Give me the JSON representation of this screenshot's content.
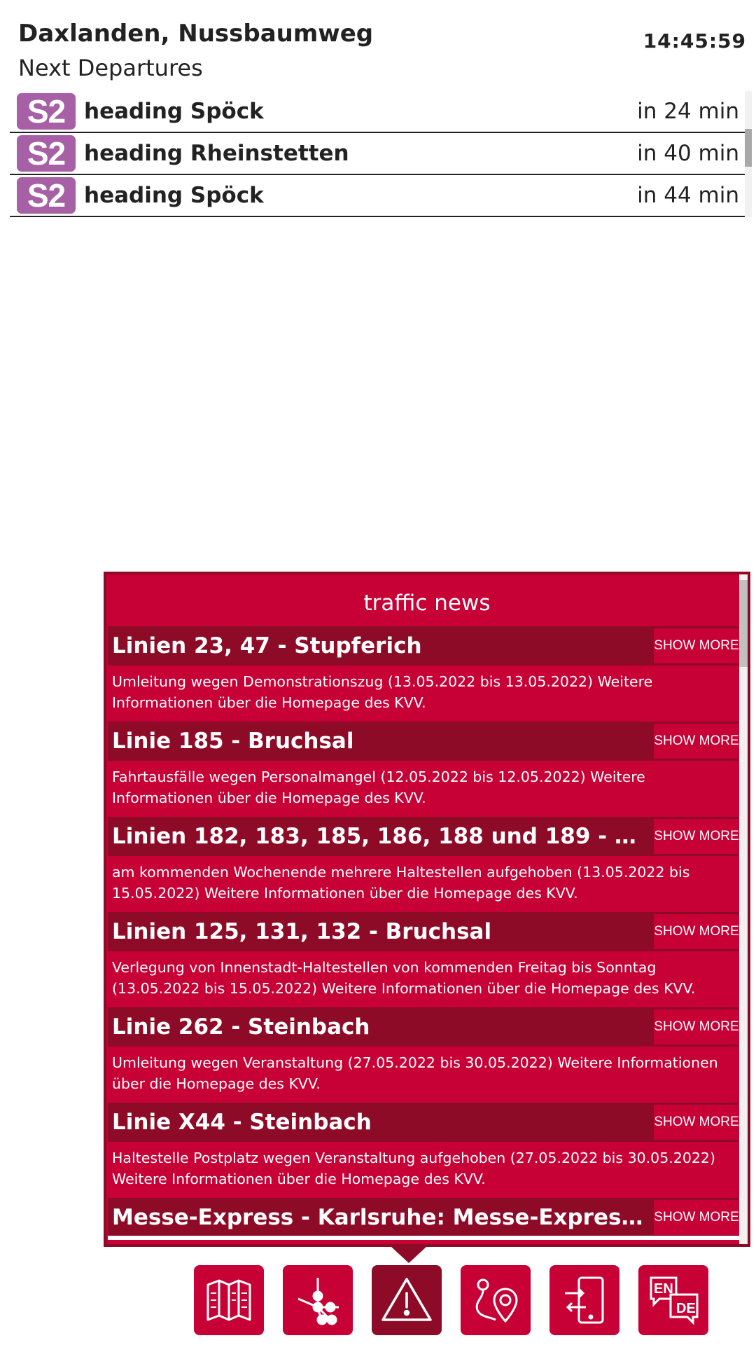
{
  "stop": {
    "name": "Daxlanden, Nussbaumweg",
    "subtitle": "Next Departures",
    "clock": "14:45:59"
  },
  "departures": [
    {
      "line": "S2",
      "destination": "heading Spöck",
      "time": "in 24 min"
    },
    {
      "line": "S2",
      "destination": "heading Rheinstetten",
      "time": "in 40 min"
    },
    {
      "line": "S2",
      "destination": "heading Spöck",
      "time": "in 44 min"
    }
  ],
  "news": {
    "title": "traffic news",
    "show_more_label": "SHOW MORE",
    "items": [
      {
        "title": "Linien 23, 47 - Stupferich",
        "body": "Umleitung wegen Demonstrationszug (13.05.2022 bis 13.05.2022) Weitere Informationen über die Homepage des KVV."
      },
      {
        "title": "Linie 185 - Bruchsal",
        "body": "Fahrtausfälle wegen Personalmangel (12.05.2022 bis 12.05.2022) Weitere Informationen über die Homepage des KVV."
      },
      {
        "title": "Linien 182, 183, 185, 186, 188 und 189 - B...",
        "body": "am kommenden Wochenende mehrere Haltestellen aufgehoben (13.05.2022 bis 15.05.2022) Weitere Informationen über die Homepage des KVV."
      },
      {
        "title": "Linien 125, 131, 132 - Bruchsal",
        "body": "Verlegung von Innenstadt-Haltestellen von kommenden Freitag bis Sonntag (13.05.2022 bis 15.05.2022) Weitere Informationen über die Homepage des KVV."
      },
      {
        "title": "Linie 262 - Steinbach",
        "body": "Umleitung wegen Veranstaltung (27.05.2022 bis 30.05.2022) Weitere Informationen über die Homepage des KVV."
      },
      {
        "title": "Linie X44 - Steinbach",
        "body": "Haltestelle Postplatz wegen Veranstaltung aufgehoben (27.05.2022 bis 30.05.2022) Weitere Informationen über die Homepage des KVV."
      },
      {
        "title": "Messe-Express - Karlsruhe: Messe-Express ...",
        "body": ""
      }
    ]
  },
  "nav": {
    "items": [
      {
        "icon": "map-icon"
      },
      {
        "icon": "network-icon"
      },
      {
        "icon": "warning-icon"
      },
      {
        "icon": "route-location-icon"
      },
      {
        "icon": "mobile-transfer-icon"
      },
      {
        "icon": "language-icon",
        "text_en": "EN",
        "text_de": "DE"
      }
    ]
  },
  "colors": {
    "accent": "#c70036",
    "accent_dark": "#8e0b27",
    "line_s2": "#a75fa6"
  }
}
